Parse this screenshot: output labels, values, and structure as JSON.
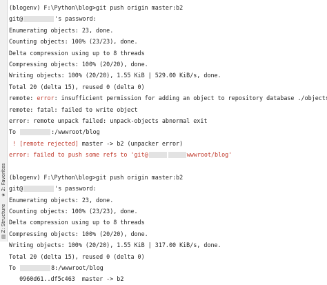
{
  "sidebar": {
    "favorites": {
      "number": "2",
      "label": "Favorites",
      "icon": "star-icon"
    },
    "structure": {
      "number": "Z",
      "label": "Structure",
      "icon": "structure-icon"
    }
  },
  "terminal": {
    "block1": {
      "l1": "(blogenv) F:\\Python\\blog>git push origin master:b2",
      "l2a": "git@",
      "l2b": "'s password:",
      "l3": "Enumerating objects: 23, done.",
      "l4": "Counting objects: 100% (23/23), done.",
      "l5": "Delta compression using up to 8 threads",
      "l6": "Compressing objects: 100% (20/20), done.",
      "l7": "Writing objects: 100% (20/20), 1.55 KiB | 529.00 KiB/s, done.",
      "l8": "Total 20 (delta 15), reused 0 (delta 0)",
      "l9a": "remote: ",
      "l9b": "error",
      "l9c": ": insufficient permission for adding an object to repository database ./objects",
      "l10": "remote: fatal: failed to write object",
      "l11": "error: remote unpack failed: unpack-objects abnormal exit",
      "l12a": "To ",
      "l12b": ":/wwwroot/blog",
      "l13a": " ! ",
      "l13b": "[remote rejected]",
      "l13c": " master -> b2 (unpacker error)",
      "l14a": "error: failed to push some refs to 'git@",
      "l14b": "wwwroot/blog'"
    },
    "block2": {
      "l1": "(blogenv) F:\\Python\\blog>git push origin master:b2",
      "l2a": "git@",
      "l2b": "'s password:",
      "l3": "Enumerating objects: 23, done.",
      "l4": "Counting objects: 100% (23/23), done.",
      "l5": "Delta compression using up to 8 threads",
      "l6": "Compressing objects: 100% (20/20), done.",
      "l7": "Writing objects: 100% (20/20), 1.55 KiB | 317.00 KiB/s, done.",
      "l8": "Total 20 (delta 15), reused 0 (delta 0)",
      "l9a": "To ",
      "l9b": "8:/wwwroot/blog",
      "l10": "   0960d61..df5c463  master -> b2"
    }
  }
}
